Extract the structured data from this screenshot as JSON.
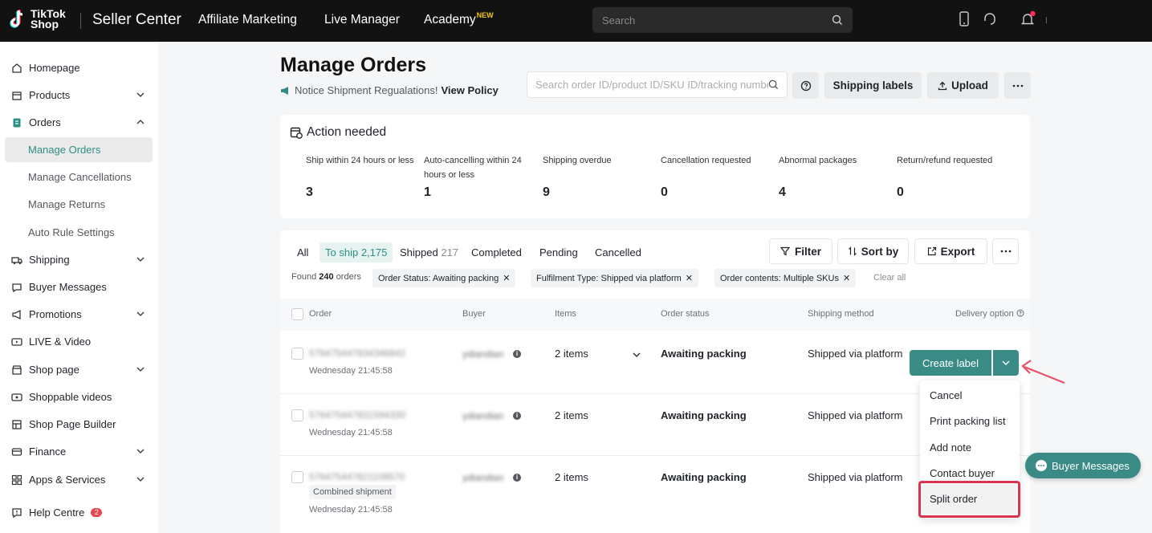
{
  "topbar": {
    "logo_line1": "TikTok",
    "logo_line2": "Shop",
    "brand": "Seller Center",
    "nav": [
      "Affiliate Marketing",
      "Live Manager",
      "Academy"
    ],
    "academy_badge": "NEW",
    "search_placeholder": "Search"
  },
  "sidebar": {
    "items": [
      {
        "label": "Homepage",
        "icon": "home-icon"
      },
      {
        "label": "Products",
        "icon": "box-icon"
      },
      {
        "label": "Orders",
        "icon": "orders-icon"
      },
      {
        "label": "Shipping",
        "icon": "truck-icon"
      },
      {
        "label": "Buyer Messages",
        "icon": "message-icon"
      },
      {
        "label": "Promotions",
        "icon": "megaphone-icon"
      },
      {
        "label": "LIVE & Video",
        "icon": "video-icon"
      },
      {
        "label": "Shop page",
        "icon": "shop-icon"
      },
      {
        "label": "Shoppable videos",
        "icon": "play-icon"
      },
      {
        "label": "Shop Page Builder",
        "icon": "builder-icon"
      },
      {
        "label": "Finance",
        "icon": "wallet-icon"
      },
      {
        "label": "Apps & Services",
        "icon": "apps-icon"
      },
      {
        "label": "Help Centre",
        "icon": "help-icon"
      }
    ],
    "order_subitems": [
      "Manage Orders",
      "Manage Cancellations",
      "Manage Returns",
      "Auto Rule Settings"
    ],
    "help_badge": "2"
  },
  "header": {
    "title": "Manage Orders",
    "notice": "Notice Shipment Regualations!",
    "notice_link": "View Policy",
    "search_placeholder": "Search order ID/product ID/SKU ID/tracking number",
    "shipping_labels": "Shipping labels",
    "upload": "Upload"
  },
  "action_needed": {
    "title": "Action needed",
    "metrics": [
      {
        "label": "Ship within 24 hours or less",
        "value": "3"
      },
      {
        "label": "Auto-cancelling within 24 hours or less",
        "value": "1"
      },
      {
        "label": "Shipping overdue",
        "value": "9"
      },
      {
        "label": "Cancellation requested",
        "value": "0"
      },
      {
        "label": "Abnormal packages",
        "value": "4"
      },
      {
        "label": "Return/refund requested",
        "value": "0"
      }
    ]
  },
  "tabs": {
    "all": "All",
    "to_ship": "To ship",
    "to_ship_count": "2,175",
    "shipped": "Shipped",
    "shipped_count": "217",
    "completed": "Completed",
    "pending": "Pending",
    "cancelled": "Cancelled"
  },
  "toolbar": {
    "filter": "Filter",
    "sort": "Sort by",
    "export": "Export"
  },
  "filters": {
    "found_prefix": "Found",
    "found_count": "240",
    "found_suffix": "orders",
    "chips": [
      "Order Status:  Awaiting packing",
      "Fulfilment Type:  Shipped via platform",
      "Order contents:  Multiple SKUs"
    ],
    "clear_all": "Clear all"
  },
  "table": {
    "headers": [
      "Order",
      "Buyer",
      "Items",
      "Order status",
      "Shipping method",
      "Delivery option"
    ],
    "rows": [
      {
        "id": "576475447834346842",
        "time": "Wednesday 21:45:58",
        "buyer": "ydiandian",
        "items": "2 items",
        "status": "Awaiting packing",
        "shipping": "Shipped via platform"
      },
      {
        "id": "576475447831594330",
        "time": "Wednesday 21:45:58",
        "buyer": "ydiandian",
        "items": "2 items",
        "status": "Awaiting packing",
        "shipping": "Shipped via platform"
      },
      {
        "id": "576475447821108570",
        "time": "Wednesday 21:45:58",
        "buyer": "ydiandian",
        "items": "2 items",
        "status": "Awaiting packing",
        "shipping": "Shipped via platform",
        "tag": "Combined shipment"
      }
    ]
  },
  "actions": {
    "create_label": "Create label",
    "menu": [
      "Cancel",
      "Print packing list",
      "Add note",
      "Contact buyer",
      "Split order"
    ]
  },
  "floating": {
    "buyer_messages": "Buyer Messages"
  },
  "colors": {
    "accent": "#3a8b86",
    "highlight": "#d9344e"
  }
}
